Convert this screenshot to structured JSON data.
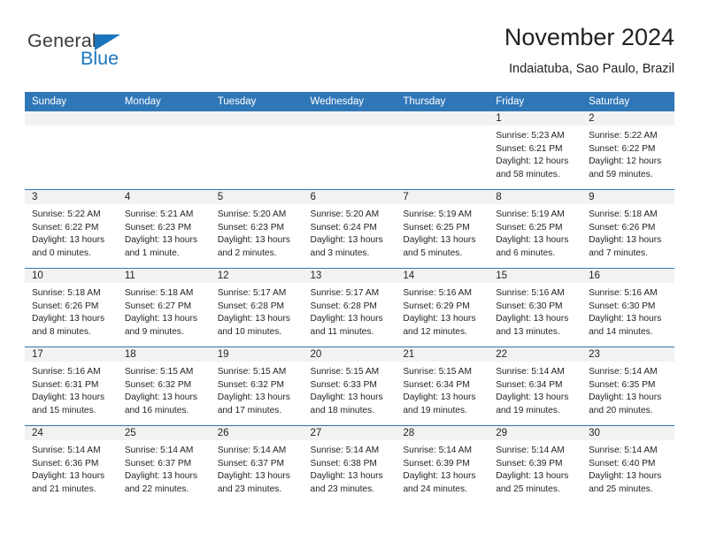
{
  "logo": {
    "word1": "General",
    "word2": "Blue",
    "accent_color": "#1b75bc",
    "triangle_icon": "triangle-icon"
  },
  "header": {
    "title": "November 2024",
    "subtitle": "Indaiatuba, Sao Paulo, Brazil"
  },
  "colors": {
    "header_blue": "#3077b8",
    "row_divider_blue": "#3077b8",
    "daynum_band_gray": "#f2f2f2",
    "text": "#231f20"
  },
  "weekday_headers": [
    "Sunday",
    "Monday",
    "Tuesday",
    "Wednesday",
    "Thursday",
    "Friday",
    "Saturday"
  ],
  "labels": {
    "sunrise_prefix": "Sunrise:",
    "sunset_prefix": "Sunset:",
    "daylight_prefix": "Daylight:"
  },
  "weeks": [
    [
      {
        "day": "",
        "empty": true
      },
      {
        "day": "",
        "empty": true
      },
      {
        "day": "",
        "empty": true
      },
      {
        "day": "",
        "empty": true
      },
      {
        "day": "",
        "empty": true
      },
      {
        "day": "1",
        "sunrise": "Sunrise: 5:23 AM",
        "sunset": "Sunset: 6:21 PM",
        "daylight_line1": "Daylight: 12 hours",
        "daylight_line2": "and 58 minutes."
      },
      {
        "day": "2",
        "sunrise": "Sunrise: 5:22 AM",
        "sunset": "Sunset: 6:22 PM",
        "daylight_line1": "Daylight: 12 hours",
        "daylight_line2": "and 59 minutes."
      }
    ],
    [
      {
        "day": "3",
        "sunrise": "Sunrise: 5:22 AM",
        "sunset": "Sunset: 6:22 PM",
        "daylight_line1": "Daylight: 13 hours",
        "daylight_line2": "and 0 minutes."
      },
      {
        "day": "4",
        "sunrise": "Sunrise: 5:21 AM",
        "sunset": "Sunset: 6:23 PM",
        "daylight_line1": "Daylight: 13 hours",
        "daylight_line2": "and 1 minute."
      },
      {
        "day": "5",
        "sunrise": "Sunrise: 5:20 AM",
        "sunset": "Sunset: 6:23 PM",
        "daylight_line1": "Daylight: 13 hours",
        "daylight_line2": "and 2 minutes."
      },
      {
        "day": "6",
        "sunrise": "Sunrise: 5:20 AM",
        "sunset": "Sunset: 6:24 PM",
        "daylight_line1": "Daylight: 13 hours",
        "daylight_line2": "and 3 minutes."
      },
      {
        "day": "7",
        "sunrise": "Sunrise: 5:19 AM",
        "sunset": "Sunset: 6:25 PM",
        "daylight_line1": "Daylight: 13 hours",
        "daylight_line2": "and 5 minutes."
      },
      {
        "day": "8",
        "sunrise": "Sunrise: 5:19 AM",
        "sunset": "Sunset: 6:25 PM",
        "daylight_line1": "Daylight: 13 hours",
        "daylight_line2": "and 6 minutes."
      },
      {
        "day": "9",
        "sunrise": "Sunrise: 5:18 AM",
        "sunset": "Sunset: 6:26 PM",
        "daylight_line1": "Daylight: 13 hours",
        "daylight_line2": "and 7 minutes."
      }
    ],
    [
      {
        "day": "10",
        "sunrise": "Sunrise: 5:18 AM",
        "sunset": "Sunset: 6:26 PM",
        "daylight_line1": "Daylight: 13 hours",
        "daylight_line2": "and 8 minutes."
      },
      {
        "day": "11",
        "sunrise": "Sunrise: 5:18 AM",
        "sunset": "Sunset: 6:27 PM",
        "daylight_line1": "Daylight: 13 hours",
        "daylight_line2": "and 9 minutes."
      },
      {
        "day": "12",
        "sunrise": "Sunrise: 5:17 AM",
        "sunset": "Sunset: 6:28 PM",
        "daylight_line1": "Daylight: 13 hours",
        "daylight_line2": "and 10 minutes."
      },
      {
        "day": "13",
        "sunrise": "Sunrise: 5:17 AM",
        "sunset": "Sunset: 6:28 PM",
        "daylight_line1": "Daylight: 13 hours",
        "daylight_line2": "and 11 minutes."
      },
      {
        "day": "14",
        "sunrise": "Sunrise: 5:16 AM",
        "sunset": "Sunset: 6:29 PM",
        "daylight_line1": "Daylight: 13 hours",
        "daylight_line2": "and 12 minutes."
      },
      {
        "day": "15",
        "sunrise": "Sunrise: 5:16 AM",
        "sunset": "Sunset: 6:30 PM",
        "daylight_line1": "Daylight: 13 hours",
        "daylight_line2": "and 13 minutes."
      },
      {
        "day": "16",
        "sunrise": "Sunrise: 5:16 AM",
        "sunset": "Sunset: 6:30 PM",
        "daylight_line1": "Daylight: 13 hours",
        "daylight_line2": "and 14 minutes."
      }
    ],
    [
      {
        "day": "17",
        "sunrise": "Sunrise: 5:16 AM",
        "sunset": "Sunset: 6:31 PM",
        "daylight_line1": "Daylight: 13 hours",
        "daylight_line2": "and 15 minutes."
      },
      {
        "day": "18",
        "sunrise": "Sunrise: 5:15 AM",
        "sunset": "Sunset: 6:32 PM",
        "daylight_line1": "Daylight: 13 hours",
        "daylight_line2": "and 16 minutes."
      },
      {
        "day": "19",
        "sunrise": "Sunrise: 5:15 AM",
        "sunset": "Sunset: 6:32 PM",
        "daylight_line1": "Daylight: 13 hours",
        "daylight_line2": "and 17 minutes."
      },
      {
        "day": "20",
        "sunrise": "Sunrise: 5:15 AM",
        "sunset": "Sunset: 6:33 PM",
        "daylight_line1": "Daylight: 13 hours",
        "daylight_line2": "and 18 minutes."
      },
      {
        "day": "21",
        "sunrise": "Sunrise: 5:15 AM",
        "sunset": "Sunset: 6:34 PM",
        "daylight_line1": "Daylight: 13 hours",
        "daylight_line2": "and 19 minutes."
      },
      {
        "day": "22",
        "sunrise": "Sunrise: 5:14 AM",
        "sunset": "Sunset: 6:34 PM",
        "daylight_line1": "Daylight: 13 hours",
        "daylight_line2": "and 19 minutes."
      },
      {
        "day": "23",
        "sunrise": "Sunrise: 5:14 AM",
        "sunset": "Sunset: 6:35 PM",
        "daylight_line1": "Daylight: 13 hours",
        "daylight_line2": "and 20 minutes."
      }
    ],
    [
      {
        "day": "24",
        "sunrise": "Sunrise: 5:14 AM",
        "sunset": "Sunset: 6:36 PM",
        "daylight_line1": "Daylight: 13 hours",
        "daylight_line2": "and 21 minutes."
      },
      {
        "day": "25",
        "sunrise": "Sunrise: 5:14 AM",
        "sunset": "Sunset: 6:37 PM",
        "daylight_line1": "Daylight: 13 hours",
        "daylight_line2": "and 22 minutes."
      },
      {
        "day": "26",
        "sunrise": "Sunrise: 5:14 AM",
        "sunset": "Sunset: 6:37 PM",
        "daylight_line1": "Daylight: 13 hours",
        "daylight_line2": "and 23 minutes."
      },
      {
        "day": "27",
        "sunrise": "Sunrise: 5:14 AM",
        "sunset": "Sunset: 6:38 PM",
        "daylight_line1": "Daylight: 13 hours",
        "daylight_line2": "and 23 minutes."
      },
      {
        "day": "28",
        "sunrise": "Sunrise: 5:14 AM",
        "sunset": "Sunset: 6:39 PM",
        "daylight_line1": "Daylight: 13 hours",
        "daylight_line2": "and 24 minutes."
      },
      {
        "day": "29",
        "sunrise": "Sunrise: 5:14 AM",
        "sunset": "Sunset: 6:39 PM",
        "daylight_line1": "Daylight: 13 hours",
        "daylight_line2": "and 25 minutes."
      },
      {
        "day": "30",
        "sunrise": "Sunrise: 5:14 AM",
        "sunset": "Sunset: 6:40 PM",
        "daylight_line1": "Daylight: 13 hours",
        "daylight_line2": "and 25 minutes."
      }
    ]
  ]
}
